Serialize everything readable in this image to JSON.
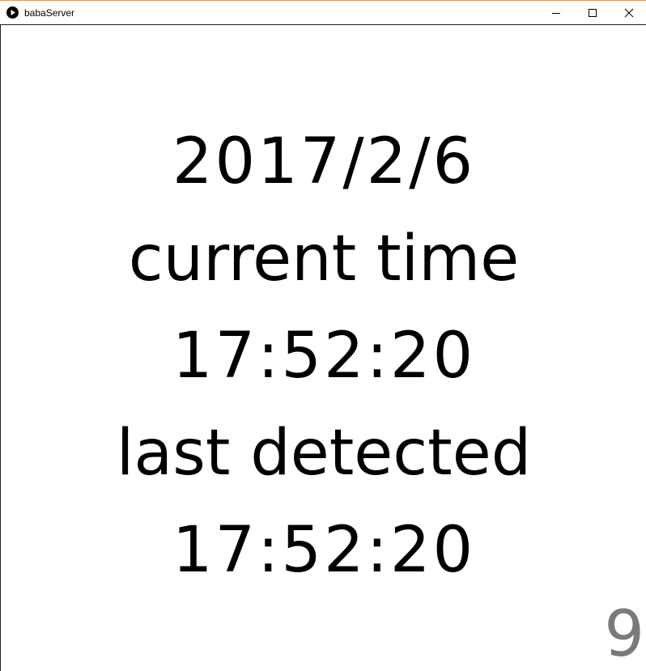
{
  "window": {
    "title": "babaServer",
    "app_icon": "play-circle-icon",
    "controls": {
      "minimize_icon": "minimize-icon",
      "maximize_icon": "maximize-icon",
      "close_icon": "close-icon"
    }
  },
  "display": {
    "date": "2017/2/6",
    "current_label": "current time",
    "current_time": "17:52:20",
    "last_label": "last detected",
    "last_time": "17:52:20",
    "counter": "9"
  },
  "colors": {
    "text": "#000000",
    "counter": "#7a7a7a",
    "background": "#ffffff",
    "titlebar_accent": "#d39a6a"
  }
}
